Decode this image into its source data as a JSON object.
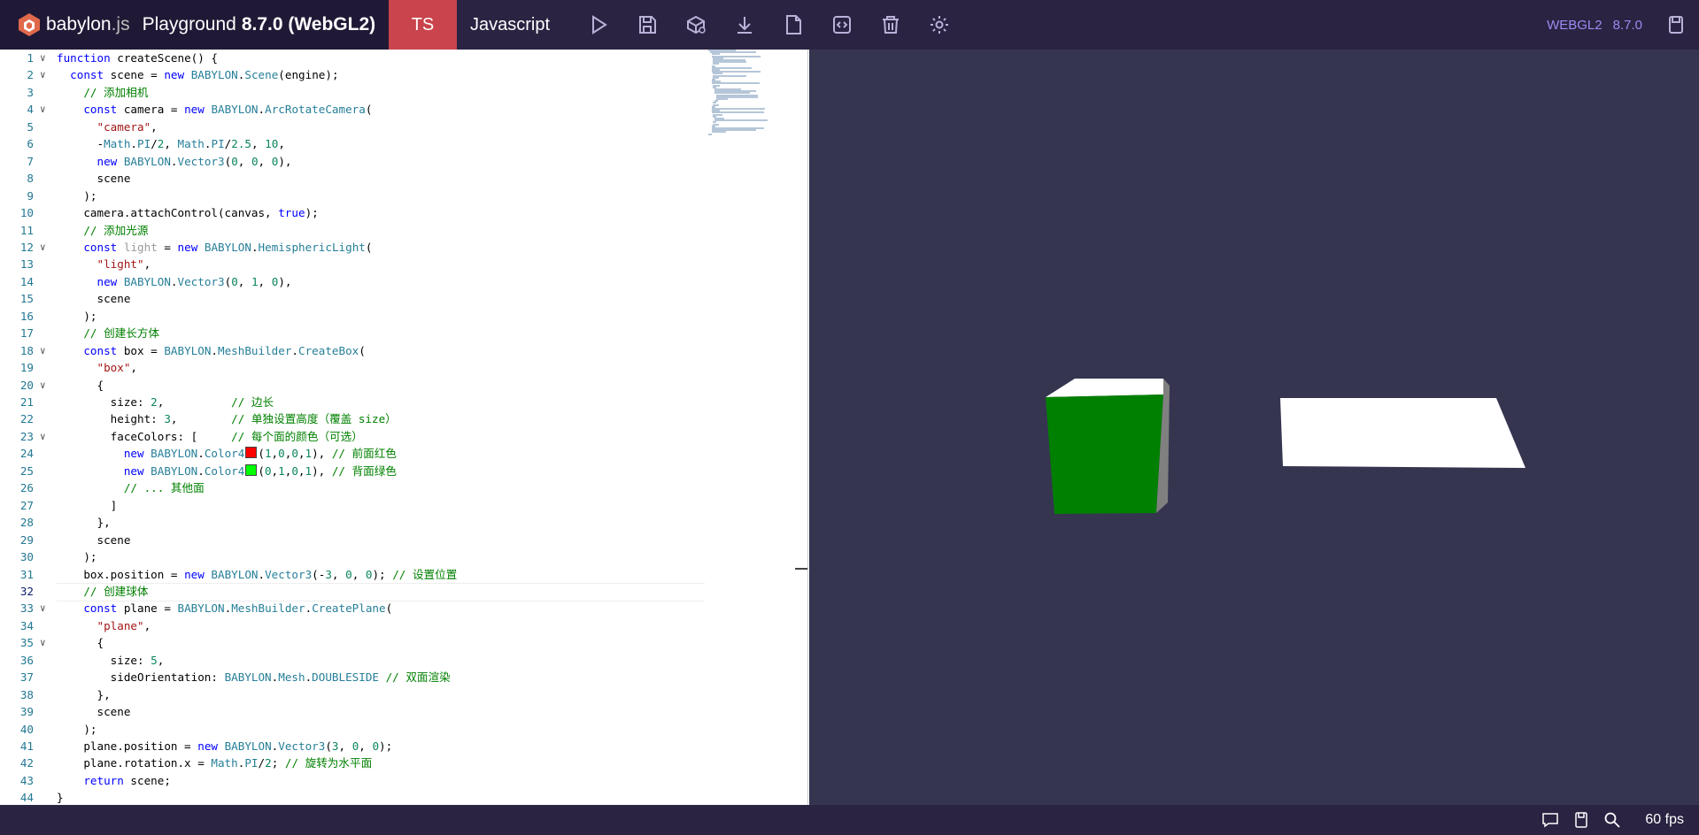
{
  "header": {
    "brand_name": "babylon",
    "brand_suffix": ".js",
    "app_title": "Playground",
    "version_label": "8.7.0 (WebGL2)",
    "tab_ts": "TS",
    "tab_js": "Javascript",
    "toolbar_icons": [
      "play-icon",
      "save-icon",
      "inspector-icon",
      "download-icon",
      "new-file-icon",
      "format-code-icon",
      "delete-icon",
      "settings-icon"
    ],
    "engine_label": "WEBGL2",
    "engine_version": "8.7.0",
    "accent_color": "#c9444c"
  },
  "editor": {
    "line_numbers": [
      "1",
      "2",
      "3",
      "4",
      "5",
      "6",
      "7",
      "8",
      "9",
      "10",
      "11",
      "12",
      "13",
      "14",
      "15",
      "16",
      "17",
      "18",
      "19",
      "20",
      "21",
      "22",
      "23",
      "24",
      "25",
      "26",
      "27",
      "28",
      "29",
      "30",
      "31",
      "32",
      "33",
      "34",
      "35",
      "36",
      "37",
      "38",
      "39",
      "40",
      "41",
      "42",
      "43",
      "44"
    ],
    "active_line": "32",
    "lines": [
      "function createScene() {",
      "  const scene = new BABYLON.Scene(engine);",
      "    // 添加相机",
      "    const camera = new BABYLON.ArcRotateCamera(",
      "      \"camera\",",
      "      -Math.PI/2, Math.PI/2.5, 10,",
      "      new BABYLON.Vector3(0, 0, 0),",
      "      scene",
      "    );",
      "    camera.attachControl(canvas, true);",
      "    // 添加光源",
      "    const light = new BABYLON.HemisphericLight(",
      "      \"light\",",
      "      new BABYLON.Vector3(0, 1, 0),",
      "      scene",
      "    );",
      "    // 创建长方体",
      "    const box = BABYLON.MeshBuilder.CreateBox(",
      "      \"box\",",
      "      {",
      "        size: 2,          // 边长",
      "        height: 3,        // 单独设置高度（覆盖 size）",
      "        faceColors: [     // 每个面的颜色（可选）",
      "          new BABYLON.Color4(1,0,0,1), // 前面红色",
      "          new BABYLON.Color4(0,1,0,1), // 背面绿色",
      "          // ... 其他面",
      "        ]",
      "      },",
      "      scene",
      "    );",
      "    box.position = new BABYLON.Vector3(-3, 0, 0); // 设置位置",
      "    // 创建球体",
      "    const plane = BABYLON.MeshBuilder.CreatePlane(",
      "      \"plane\",",
      "      {",
      "        size: 5,",
      "        sideOrientation: BABYLON.Mesh.DOUBLESIDE // 双面渲染",
      "      },",
      "      scene",
      "    );",
      "    plane.position = new BABYLON.Vector3(3, 0, 0);",
      "    plane.rotation.x = Math.PI/2; // 旋转为水平面",
      "    return scene;",
      "}"
    ],
    "swatch_colors": [
      "#ff0000",
      "#00ff00"
    ]
  },
  "viewport": {
    "background": "#353550",
    "box_front_color": "#008000",
    "plane_color": "#ffffff"
  },
  "status": {
    "icons": [
      "comment-icon",
      "book-icon",
      "search-icon"
    ],
    "fps": "60 fps"
  }
}
